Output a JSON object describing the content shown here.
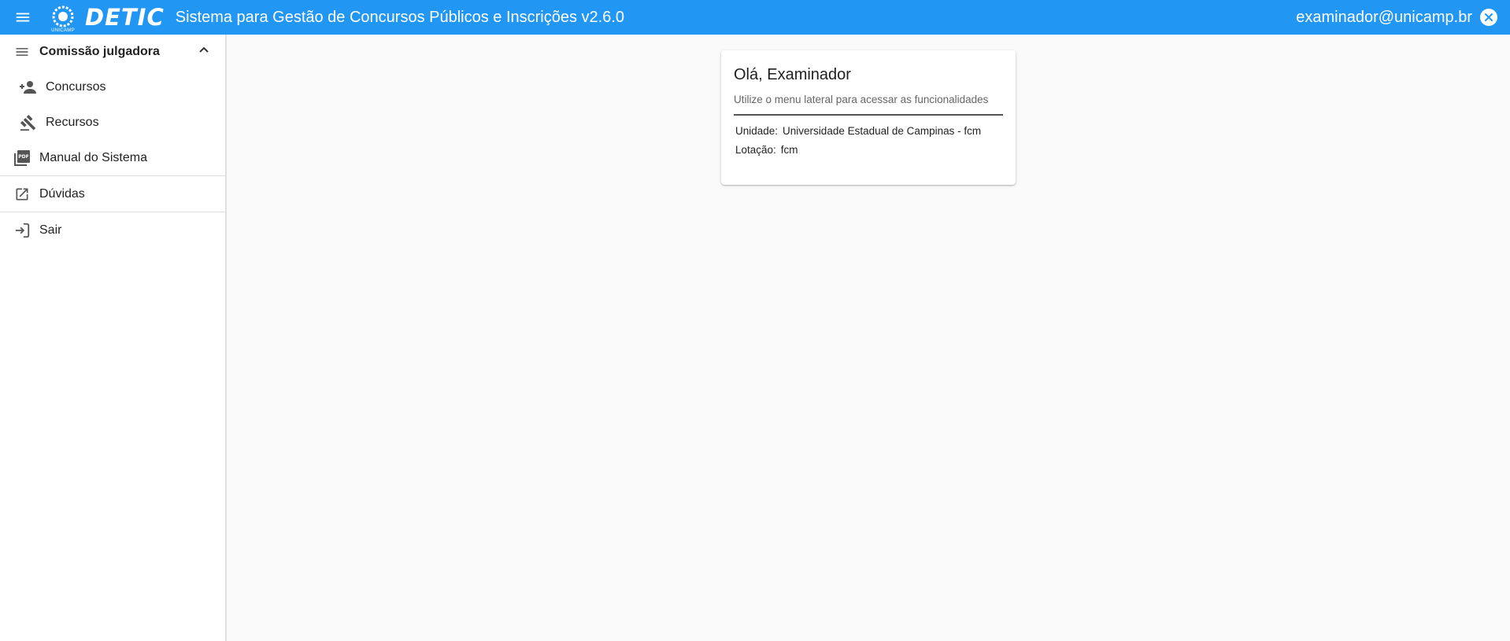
{
  "header": {
    "logo_unicamp_label": "UNICAMP",
    "logo_detic": "DETIC",
    "title": "Sistema para Gestão de Concursos Públicos e Inscrições v2.6.0",
    "user_email": "examinador@unicamp.br",
    "accent_color": "#2196f3"
  },
  "sidebar": {
    "group": {
      "label": "Comissão julgadora",
      "icon": "menu-lines-icon",
      "expanded": true
    },
    "sub_items": [
      {
        "label": "Concursos",
        "icon": "person-add-icon"
      },
      {
        "label": "Recursos",
        "icon": "gavel-icon"
      }
    ],
    "items": [
      {
        "label": "Manual do Sistema",
        "icon": "pdf-icon"
      },
      {
        "label": "Dúvidas",
        "icon": "open-in-new-icon"
      },
      {
        "label": "Sair",
        "icon": "login-icon"
      }
    ]
  },
  "welcome_card": {
    "title": "Olá, Examinador",
    "subtitle": "Utilize o menu lateral para acessar as funcionalidades",
    "unidade_label": "Unidade:",
    "unidade_value": "Universidade Estadual de Campinas - fcm",
    "lotacao_label": "Lotação:",
    "lotacao_value": "fcm"
  }
}
